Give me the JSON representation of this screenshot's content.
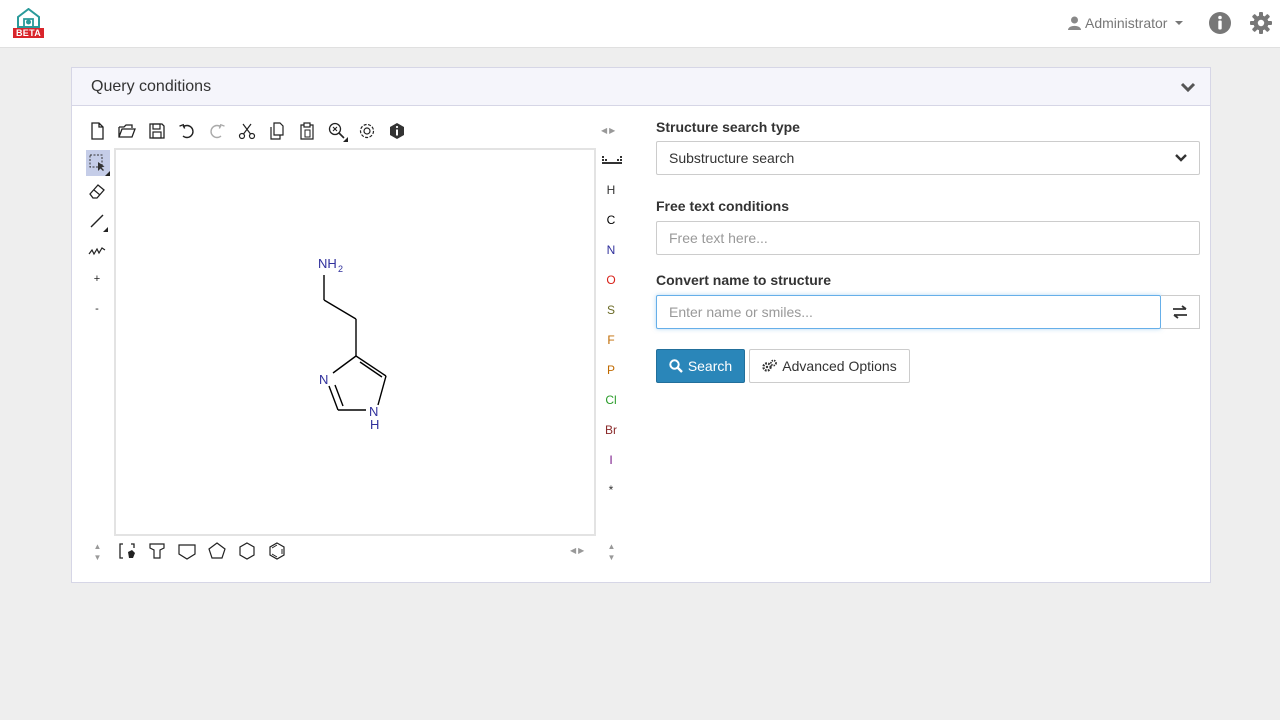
{
  "navbar": {
    "logo_badge": "BETA",
    "user_label": "Administrator",
    "icons": [
      "user-icon",
      "info-icon",
      "gear-icon"
    ]
  },
  "panel": {
    "title": "Query conditions"
  },
  "sketcher": {
    "top_toolbar": [
      "new-document",
      "open-file",
      "save",
      "undo",
      "redo",
      "cut",
      "copy",
      "paste",
      "zoom",
      "settings",
      "about"
    ],
    "left_toolbar": [
      "selection",
      "eraser",
      "single-bond",
      "chain",
      "charge-plus",
      "charge-minus"
    ],
    "left_labels": {
      "plus": "+",
      "minus": "-"
    },
    "bottom_toolbar": [
      "template-shapes",
      "cyclopropane",
      "cyclobutane",
      "cyclopentane",
      "cyclohexane",
      "benzene"
    ],
    "elements": [
      {
        "symbol": "H",
        "color": "#333333"
      },
      {
        "symbol": "C",
        "color": "#000000"
      },
      {
        "symbol": "N",
        "color": "#30309c"
      },
      {
        "symbol": "O",
        "color": "#d8221a"
      },
      {
        "symbol": "S",
        "color": "#6a6a26"
      },
      {
        "symbol": "F",
        "color": "#c06a00"
      },
      {
        "symbol": "P",
        "color": "#c06a00"
      },
      {
        "symbol": "Cl",
        "color": "#2a9c2a"
      },
      {
        "symbol": "Br",
        "color": "#8a2a2a"
      },
      {
        "symbol": "I",
        "color": "#7a1a8a"
      },
      {
        "symbol": "*",
        "color": "#333333"
      }
    ],
    "molecule_labels": {
      "amine": "NH",
      "amine_sub": "2",
      "ring_n": "N",
      "ring_nh_n": "N",
      "ring_nh_h": "H"
    }
  },
  "form": {
    "structure_type_label": "Structure search type",
    "structure_type_value": "Substructure search",
    "free_text_label": "Free text conditions",
    "free_text_placeholder": "Free text here...",
    "convert_label": "Convert name to structure",
    "convert_placeholder": "Enter name or smiles...",
    "search_button": "Search",
    "advanced_button": "Advanced Options"
  },
  "colors": {
    "primary": "#2a86b9",
    "beta_badge": "#d9252b",
    "logo_teal": "#2a9a9a",
    "atom_n": "#30309c"
  }
}
